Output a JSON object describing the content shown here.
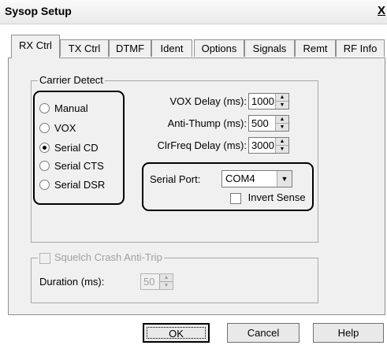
{
  "window": {
    "title": "Sysop Setup",
    "close_label": "X"
  },
  "tabs": [
    {
      "label": "RX Ctrl",
      "active": true
    },
    {
      "label": "TX Ctrl"
    },
    {
      "label": "DTMF"
    },
    {
      "label": "Ident"
    },
    {
      "label": "Options"
    },
    {
      "label": "Signals"
    },
    {
      "label": "Remt"
    },
    {
      "label": "RF Info"
    }
  ],
  "carrier_detect": {
    "legend": "Carrier Detect",
    "options": [
      {
        "label": "Manual",
        "selected": false
      },
      {
        "label": "VOX",
        "selected": false
      },
      {
        "label": "Serial CD",
        "selected": true
      },
      {
        "label": "Serial CTS",
        "selected": false
      },
      {
        "label": "Serial DSR",
        "selected": false
      }
    ],
    "vox_delay": {
      "label": "VOX Delay (ms):",
      "value": "1000"
    },
    "anti_thump": {
      "label": "Anti-Thump (ms):",
      "value": "500"
    },
    "clrfreq_delay": {
      "label": "ClrFreq Delay (ms):",
      "value": "3000"
    },
    "serial_port": {
      "label": "Serial Port:",
      "value": "COM4"
    },
    "invert_sense": {
      "label": "Invert Sense",
      "checked": false
    }
  },
  "squelch": {
    "legend": "Squelch Crash Anti-Trip",
    "enabled": false,
    "duration": {
      "label": "Duration (ms):",
      "value": "50"
    }
  },
  "buttons": {
    "ok": "OK",
    "cancel": "Cancel",
    "help": "Help"
  }
}
